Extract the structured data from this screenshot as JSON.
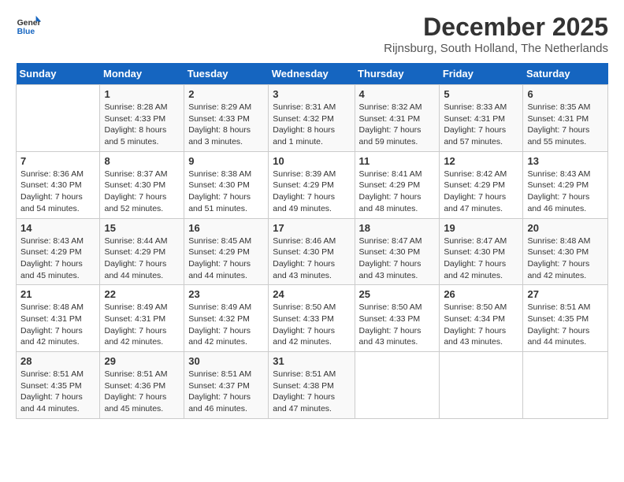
{
  "header": {
    "logo_general": "General",
    "logo_blue": "Blue",
    "month": "December 2025",
    "location": "Rijnsburg, South Holland, The Netherlands"
  },
  "days_of_week": [
    "Sunday",
    "Monday",
    "Tuesday",
    "Wednesday",
    "Thursday",
    "Friday",
    "Saturday"
  ],
  "weeks": [
    [
      {
        "day": "",
        "info": ""
      },
      {
        "day": "1",
        "info": "Sunrise: 8:28 AM\nSunset: 4:33 PM\nDaylight: 8 hours\nand 5 minutes."
      },
      {
        "day": "2",
        "info": "Sunrise: 8:29 AM\nSunset: 4:33 PM\nDaylight: 8 hours\nand 3 minutes."
      },
      {
        "day": "3",
        "info": "Sunrise: 8:31 AM\nSunset: 4:32 PM\nDaylight: 8 hours\nand 1 minute."
      },
      {
        "day": "4",
        "info": "Sunrise: 8:32 AM\nSunset: 4:31 PM\nDaylight: 7 hours\nand 59 minutes."
      },
      {
        "day": "5",
        "info": "Sunrise: 8:33 AM\nSunset: 4:31 PM\nDaylight: 7 hours\nand 57 minutes."
      },
      {
        "day": "6",
        "info": "Sunrise: 8:35 AM\nSunset: 4:31 PM\nDaylight: 7 hours\nand 55 minutes."
      }
    ],
    [
      {
        "day": "7",
        "info": "Sunrise: 8:36 AM\nSunset: 4:30 PM\nDaylight: 7 hours\nand 54 minutes."
      },
      {
        "day": "8",
        "info": "Sunrise: 8:37 AM\nSunset: 4:30 PM\nDaylight: 7 hours\nand 52 minutes."
      },
      {
        "day": "9",
        "info": "Sunrise: 8:38 AM\nSunset: 4:30 PM\nDaylight: 7 hours\nand 51 minutes."
      },
      {
        "day": "10",
        "info": "Sunrise: 8:39 AM\nSunset: 4:29 PM\nDaylight: 7 hours\nand 49 minutes."
      },
      {
        "day": "11",
        "info": "Sunrise: 8:41 AM\nSunset: 4:29 PM\nDaylight: 7 hours\nand 48 minutes."
      },
      {
        "day": "12",
        "info": "Sunrise: 8:42 AM\nSunset: 4:29 PM\nDaylight: 7 hours\nand 47 minutes."
      },
      {
        "day": "13",
        "info": "Sunrise: 8:43 AM\nSunset: 4:29 PM\nDaylight: 7 hours\nand 46 minutes."
      }
    ],
    [
      {
        "day": "14",
        "info": "Sunrise: 8:43 AM\nSunset: 4:29 PM\nDaylight: 7 hours\nand 45 minutes."
      },
      {
        "day": "15",
        "info": "Sunrise: 8:44 AM\nSunset: 4:29 PM\nDaylight: 7 hours\nand 44 minutes."
      },
      {
        "day": "16",
        "info": "Sunrise: 8:45 AM\nSunset: 4:29 PM\nDaylight: 7 hours\nand 44 minutes."
      },
      {
        "day": "17",
        "info": "Sunrise: 8:46 AM\nSunset: 4:30 PM\nDaylight: 7 hours\nand 43 minutes."
      },
      {
        "day": "18",
        "info": "Sunrise: 8:47 AM\nSunset: 4:30 PM\nDaylight: 7 hours\nand 43 minutes."
      },
      {
        "day": "19",
        "info": "Sunrise: 8:47 AM\nSunset: 4:30 PM\nDaylight: 7 hours\nand 42 minutes."
      },
      {
        "day": "20",
        "info": "Sunrise: 8:48 AM\nSunset: 4:30 PM\nDaylight: 7 hours\nand 42 minutes."
      }
    ],
    [
      {
        "day": "21",
        "info": "Sunrise: 8:48 AM\nSunset: 4:31 PM\nDaylight: 7 hours\nand 42 minutes."
      },
      {
        "day": "22",
        "info": "Sunrise: 8:49 AM\nSunset: 4:31 PM\nDaylight: 7 hours\nand 42 minutes."
      },
      {
        "day": "23",
        "info": "Sunrise: 8:49 AM\nSunset: 4:32 PM\nDaylight: 7 hours\nand 42 minutes."
      },
      {
        "day": "24",
        "info": "Sunrise: 8:50 AM\nSunset: 4:33 PM\nDaylight: 7 hours\nand 42 minutes."
      },
      {
        "day": "25",
        "info": "Sunrise: 8:50 AM\nSunset: 4:33 PM\nDaylight: 7 hours\nand 43 minutes."
      },
      {
        "day": "26",
        "info": "Sunrise: 8:50 AM\nSunset: 4:34 PM\nDaylight: 7 hours\nand 43 minutes."
      },
      {
        "day": "27",
        "info": "Sunrise: 8:51 AM\nSunset: 4:35 PM\nDaylight: 7 hours\nand 44 minutes."
      }
    ],
    [
      {
        "day": "28",
        "info": "Sunrise: 8:51 AM\nSunset: 4:35 PM\nDaylight: 7 hours\nand 44 minutes."
      },
      {
        "day": "29",
        "info": "Sunrise: 8:51 AM\nSunset: 4:36 PM\nDaylight: 7 hours\nand 45 minutes."
      },
      {
        "day": "30",
        "info": "Sunrise: 8:51 AM\nSunset: 4:37 PM\nDaylight: 7 hours\nand 46 minutes."
      },
      {
        "day": "31",
        "info": "Sunrise: 8:51 AM\nSunset: 4:38 PM\nDaylight: 7 hours\nand 47 minutes."
      },
      {
        "day": "",
        "info": ""
      },
      {
        "day": "",
        "info": ""
      },
      {
        "day": "",
        "info": ""
      }
    ]
  ]
}
